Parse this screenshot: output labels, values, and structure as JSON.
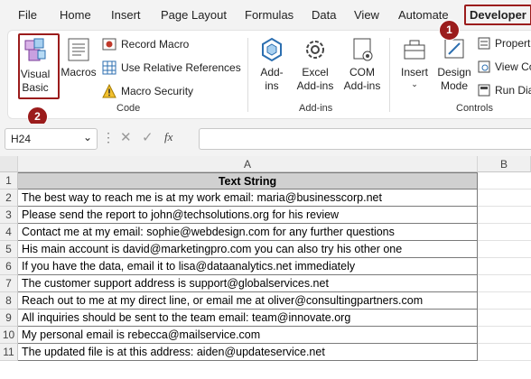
{
  "tabs": [
    {
      "label": "File"
    },
    {
      "label": "Home"
    },
    {
      "label": "Insert"
    },
    {
      "label": "Page Layout"
    },
    {
      "label": "Formulas"
    },
    {
      "label": "Data"
    },
    {
      "label": "View"
    },
    {
      "label": "Automate"
    },
    {
      "label": "Developer"
    }
  ],
  "ribbon": {
    "code_group": {
      "label": "Code",
      "visual_basic": "Visual\nBasic",
      "macros": "Macros",
      "record_macro": "Record Macro",
      "relative_refs": "Use Relative References",
      "macro_security": "Macro Security"
    },
    "addins_group": {
      "label": "Add-ins",
      "addins": "Add-\nins",
      "excel_addins": "Excel\nAdd-ins",
      "com_addins": "COM\nAdd-ins"
    },
    "controls_group": {
      "label": "Controls",
      "insert": "Insert",
      "design_mode": "Design\nMode",
      "properties": "Properti",
      "view_code": "View Co",
      "run_dialog": "Run Dia"
    }
  },
  "badges": {
    "one": "1",
    "two": "2"
  },
  "formula_bar": {
    "cell_ref": "H24",
    "fx": "fx",
    "value": ""
  },
  "grid": {
    "columns": [
      "A",
      "B"
    ],
    "header": "Text String",
    "rows": [
      "The best way to reach me is at my work email: maria@businesscorp.net",
      "Please send the report to john@techsolutions.org for his review",
      "Contact me at my email: sophie@webdesign.com for any further questions",
      "His main account is david@marketingpro.com you can also try his other one",
      "If you have the data, email it to lisa@dataanalytics.net immediately",
      "The customer support address is support@globalservices.net",
      "Reach out to me at my direct line, or email me at oliver@consultingpartners.com",
      "All inquiries should be sent to the team email: team@innovate.org",
      "My personal email is rebecca@mailservice.com",
      "The updated file is at this address: aiden@updateservice.net"
    ],
    "row_numbers": [
      "1",
      "2",
      "3",
      "4",
      "5",
      "6",
      "7",
      "8",
      "9",
      "10",
      "11"
    ]
  },
  "colors": {
    "accent": "#9b1c1c",
    "header_fill": "#d0d0d0",
    "ribbon_bg": "#ffffff",
    "app_bg": "#f3f3f3"
  }
}
